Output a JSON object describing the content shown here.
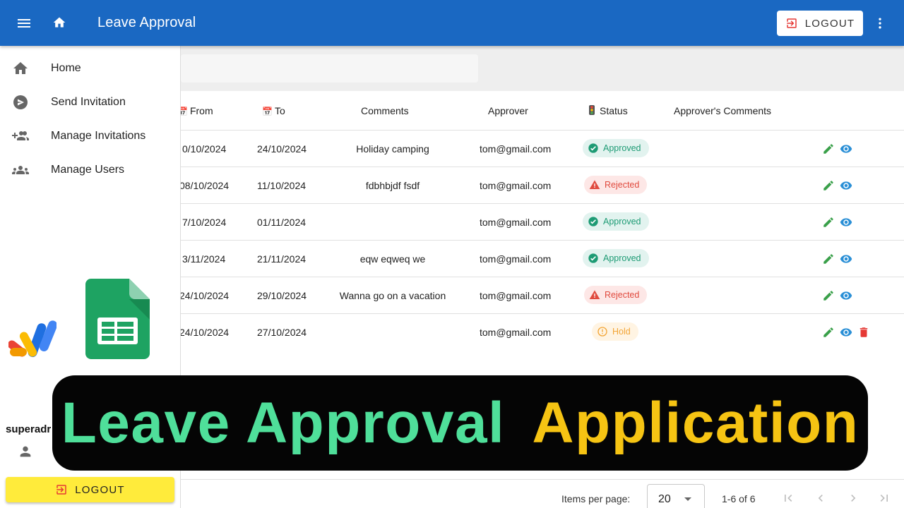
{
  "appbar": {
    "title": "Leave Approval",
    "logout_label": "LOGOUT"
  },
  "sidebar": {
    "items": [
      {
        "label": "Home",
        "icon": "home-icon"
      },
      {
        "label": "Send Invitation",
        "icon": "send-icon"
      },
      {
        "label": "Manage Invitations",
        "icon": "group-add-icon"
      },
      {
        "label": "Manage Users",
        "icon": "people-icon"
      }
    ],
    "user_name": "superadr",
    "logout_label": "LOGOUT"
  },
  "search": {
    "value": "",
    "placeholder": ""
  },
  "table": {
    "headers": {
      "from": "From",
      "to": "To",
      "comments": "Comments",
      "approver": "Approver",
      "status": "Status",
      "approver_comments": "Approver's Comments"
    },
    "rows": [
      {
        "from": "0/10/2024",
        "to": "24/10/2024",
        "comments": "Holiday camping",
        "approver": "tom@gmail.com",
        "status": "Approved",
        "status_kind": "approved",
        "actions": [
          "edit-icon",
          "view-icon"
        ]
      },
      {
        "from": "08/10/2024",
        "to": "11/10/2024",
        "comments": "fdbhbjdf fsdf",
        "approver": "tom@gmail.com",
        "status": "Rejected",
        "status_kind": "rejected",
        "actions": [
          "edit-icon",
          "view-icon"
        ]
      },
      {
        "from": "7/10/2024",
        "to": "01/11/2024",
        "comments": "",
        "approver": "tom@gmail.com",
        "status": "Approved",
        "status_kind": "approved",
        "actions": [
          "edit-icon",
          "view-icon"
        ]
      },
      {
        "from": "3/11/2024",
        "to": "21/11/2024",
        "comments": "eqw eqweq we",
        "approver": "tom@gmail.com",
        "status": "Approved",
        "status_kind": "approved",
        "actions": [
          "edit-icon",
          "view-icon"
        ]
      },
      {
        "from": "24/10/2024",
        "to": "29/10/2024",
        "comments": "Wanna go on a vacation",
        "approver": "tom@gmail.com",
        "status": "Rejected",
        "status_kind": "rejected",
        "actions": [
          "edit-icon",
          "view-icon"
        ]
      },
      {
        "from": "24/10/2024",
        "to": "27/10/2024",
        "comments": "",
        "approver": "tom@gmail.com",
        "status": "Hold",
        "status_kind": "hold",
        "actions": [
          "edit-icon",
          "view-icon",
          "delete-icon"
        ]
      }
    ]
  },
  "paginator": {
    "items_per_page_label": "Items per page:",
    "items_per_page": "20",
    "range_label": "1-6 of 6"
  },
  "banner": {
    "part1": "Leave Approval",
    "part2": "Application"
  },
  "colors": {
    "appbar": "#1a68c2",
    "approved": "#1d9b74",
    "rejected": "#e04a3e",
    "hold": "#f3a536",
    "edit": "#3aa04a",
    "view": "#2a8fd6",
    "delete": "#e53935",
    "banner_green": "#4fdf9a",
    "banner_yellow": "#f6c413"
  }
}
